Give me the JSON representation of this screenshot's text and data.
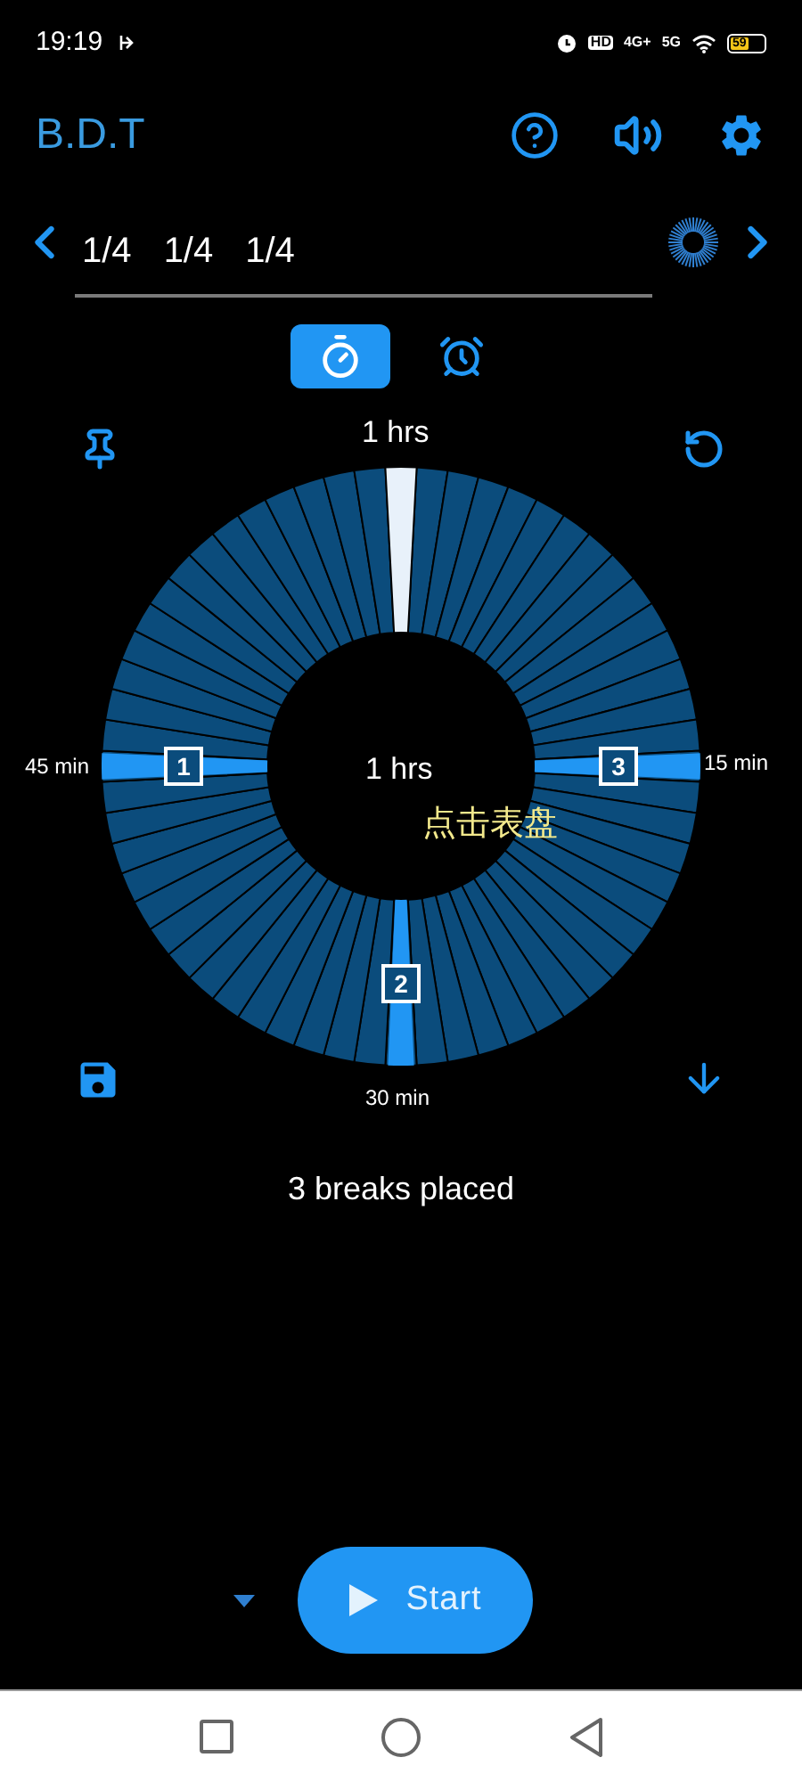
{
  "status_bar": {
    "time": "19:19",
    "indicators": [
      "HD",
      "4G+",
      "5G"
    ],
    "battery": "59"
  },
  "app_bar": {
    "title": "B.D.T"
  },
  "presets": {
    "fractions": [
      "1/4",
      "1/4",
      "1/4"
    ]
  },
  "modes": [
    {
      "kind": "timer",
      "selected": true
    },
    {
      "kind": "alarm",
      "selected": false
    }
  ],
  "dial": {
    "top_label": "1 hrs",
    "center_label": "1 hrs",
    "hint": "点击表盘",
    "markers": [
      {
        "label": "45 min",
        "kind": "left"
      },
      {
        "label": "15 min",
        "kind": "right"
      },
      {
        "label": "30 min",
        "kind": "bottom"
      }
    ],
    "breaks": [
      {
        "number": "1",
        "kind": "left"
      },
      {
        "number": "3",
        "kind": "right"
      },
      {
        "number": "2",
        "kind": "bottom"
      }
    ]
  },
  "summary": "3 breaks placed",
  "start_button": {
    "label": "Start"
  }
}
